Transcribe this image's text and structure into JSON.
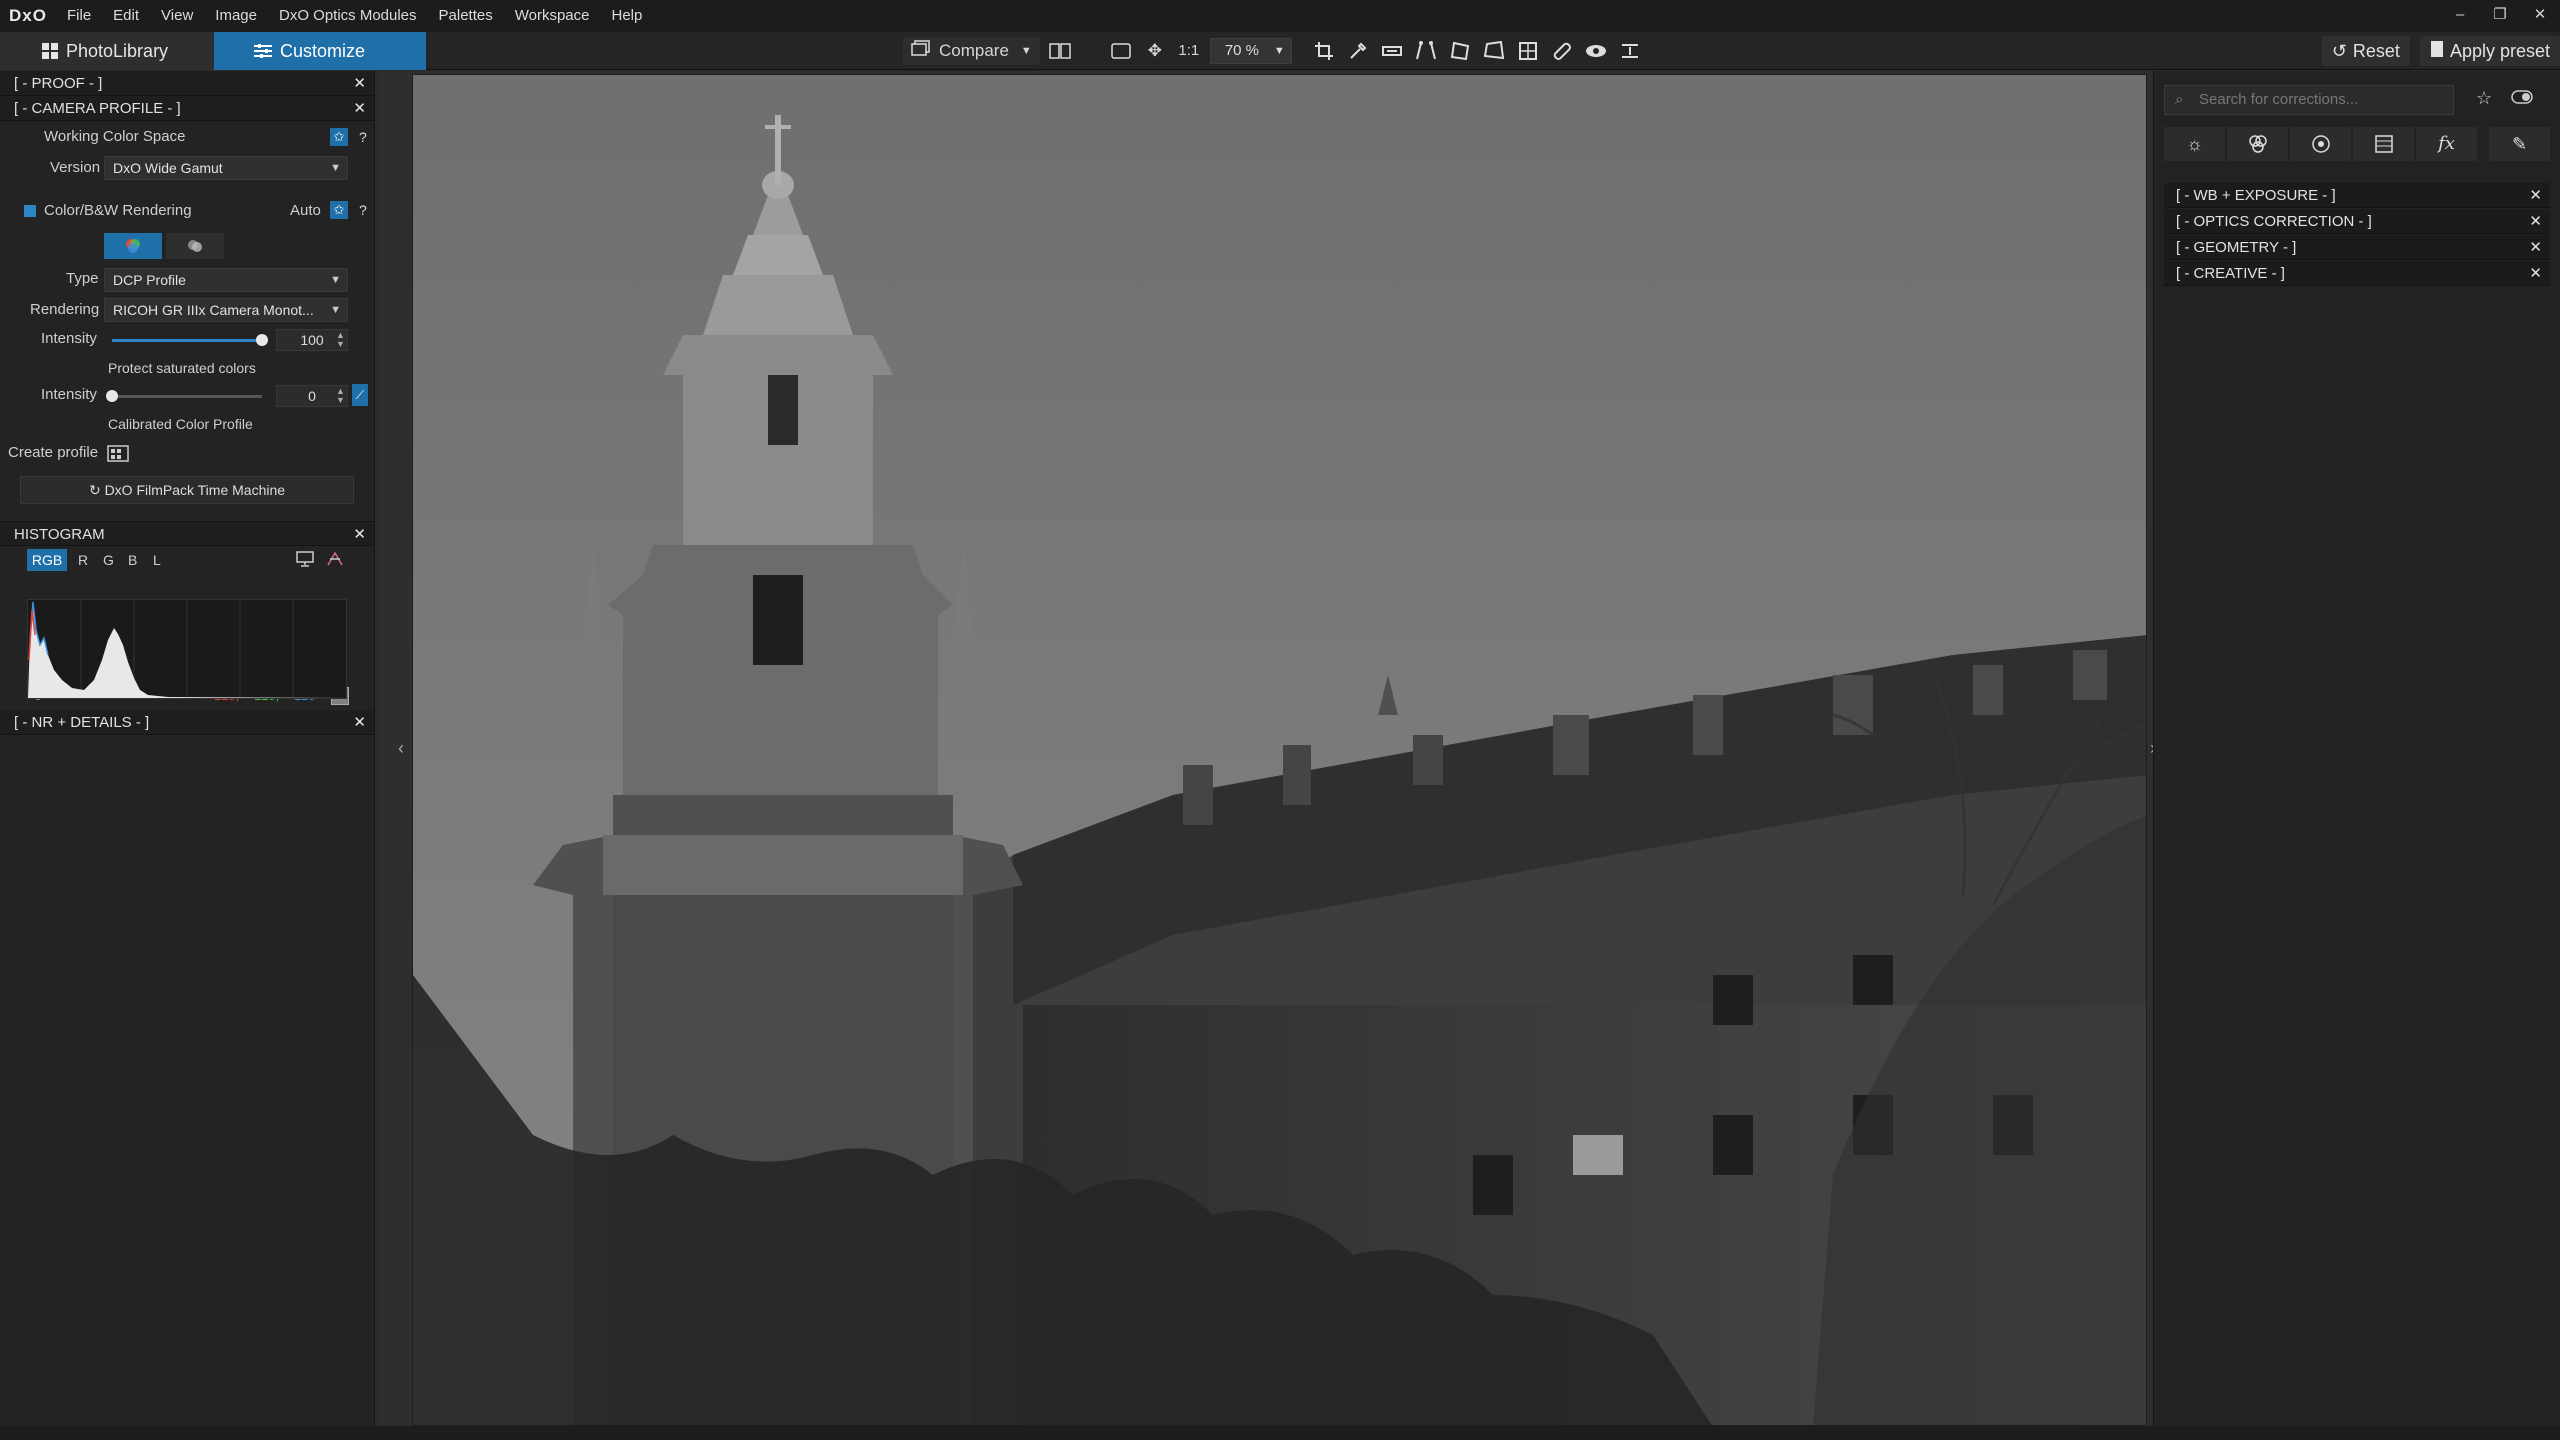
{
  "app": {
    "logo": "DxO",
    "menu": [
      "File",
      "Edit",
      "View",
      "Image",
      "DxO Optics Modules",
      "Palettes",
      "Workspace",
      "Help"
    ],
    "window_controls": [
      "–",
      "❐",
      "✕"
    ]
  },
  "toolbar": {
    "tabs": [
      {
        "label": "PhotoLibrary",
        "icon": "grid-icon"
      },
      {
        "label": "Customize",
        "icon": "sliders-icon"
      }
    ],
    "compare_label": "Compare",
    "zoom_fit_label": "1:1",
    "zoom_value": "70 %",
    "reset_label": "Reset",
    "apply_preset_label": "Apply preset"
  },
  "left_panel": {
    "proof": "[ - PROOF - ]",
    "camera_profile": "[ - CAMERA PROFILE - ]",
    "working_color_space": "Working Color Space",
    "version_label": "Version",
    "version_value": "DxO Wide Gamut",
    "color_bw_rendering": "Color/B&W Rendering",
    "auto_label": "Auto",
    "type_label": "Type",
    "type_value": "DCP Profile",
    "rendering_label": "Rendering",
    "rendering_value": "RICOH GR IIIx Camera Monot...",
    "intensity_label": "Intensity",
    "intensity_value": "100",
    "intensity_level": 1.0,
    "protect_saturated": "Protect saturated colors",
    "intensity2_label": "Intensity",
    "intensity2_value": "0",
    "intensity2_level": 0.0,
    "calibrated_profile": "Calibrated Color Profile",
    "create_profile": "Create profile",
    "filmpack_button": "DxO FilmPack Time Machine",
    "histogram_title": "HISTOGRAM",
    "histogram_channels": [
      "RGB",
      "R",
      "G",
      "B",
      "L"
    ],
    "histogram_values": {
      "r": "129,",
      "g": "129,",
      "b": "129"
    },
    "nr_details": "[ - NR + DETAILS - ]"
  },
  "right_panel": {
    "search_placeholder": "Search for corrections...",
    "sections": [
      "[ - WB + EXPOSURE - ]",
      "[ - OPTICS CORRECTION - ]",
      "[ - GEOMETRY - ]",
      "[ - CREATIVE - ]"
    ]
  },
  "colors": {
    "accent": "#1f6fa8",
    "hist_r": "#e0443a",
    "hist_g": "#4cc24c",
    "hist_b": "#3f8fe0"
  }
}
